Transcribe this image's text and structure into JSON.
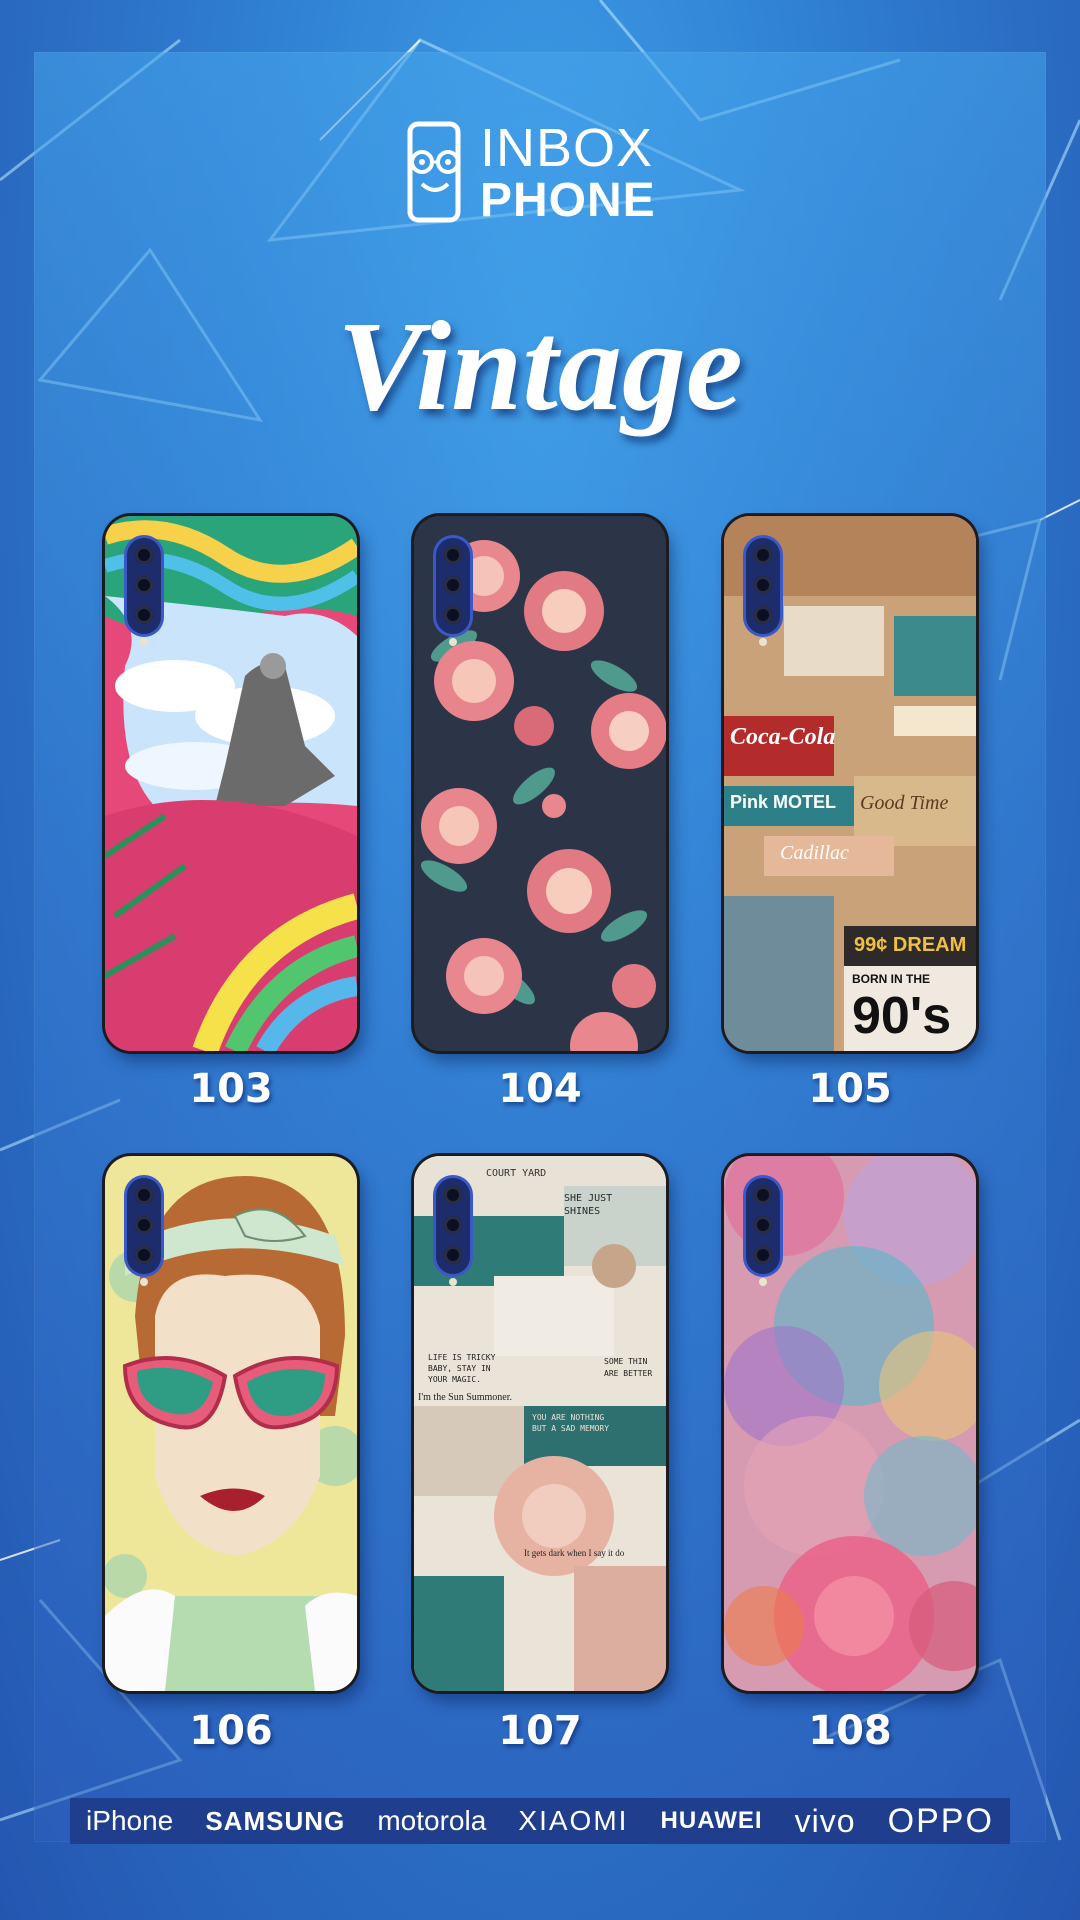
{
  "brand": {
    "line1": "INBOX",
    "line2": "PHONE"
  },
  "title": "Vintage",
  "cases": [
    {
      "code": "103",
      "design": "rainbow-clouds-collage"
    },
    {
      "code": "104",
      "design": "pink-roses-dark-navy"
    },
    {
      "code": "105",
      "design": "retro-90s-collage"
    },
    {
      "code": "106",
      "design": "pop-art-heart-glasses-girl"
    },
    {
      "code": "107",
      "design": "teal-rose-aesthetic-collage"
    },
    {
      "code": "108",
      "design": "watercolor-flowers"
    }
  ],
  "collage_texts": {
    "c105": [
      "Coca-Cola",
      "Pink MOTEL",
      "Good Time",
      "Cadillac",
      "99¢ DREAM",
      "BORN IN THE",
      "90's"
    ],
    "c107": [
      "COURT YARD",
      "SHE JUST SHINES",
      "LIFE IS TRICKY BABY, STAY IN YOUR MAGIC.",
      "SOME THIN ARE BETTER",
      "I'm the Sun Summoner.",
      "YOU ARE NOTHING BUT A SAD MEMORY",
      "It gets dark when I say it do"
    ]
  },
  "brands_bar": [
    "iPhone",
    "SAMSUNG",
    "motorola",
    "XIAOMI",
    "HUAWEI",
    "vivo",
    "OPPO"
  ],
  "colors": {
    "background": "#2d6fc4",
    "panel": "#4aa6ea",
    "brand_bar": "#1f3e8e",
    "text": "#ffffff"
  }
}
